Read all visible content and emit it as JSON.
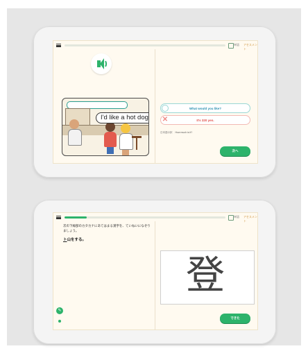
{
  "screen_1": {
    "progress_percent": 0,
    "hint_label": "単語",
    "hint_link": "アセスメント",
    "scene_text": "I'd like a hot dog.",
    "option_correct": "What would you like?",
    "option_wrong": "It's 320 yen.",
    "translation_label": "日本語の訳",
    "translation_text": "How much is it?",
    "next_button": "次へ"
  },
  "screen_2": {
    "progress_percent": 14,
    "hint_label": "単語",
    "hint_link": "アセスメント",
    "question": "次の下線部のカタカナにあてはまる漢字を、ていねいになぞりましょう。",
    "sentence_mark": "ト",
    "sentence_rest": "山をする。",
    "kanji": "登",
    "done_button": "できた"
  },
  "colors": {
    "accent": "#2db36b",
    "correct": "#2a8fb0",
    "wrong": "#e0504a",
    "screen_bg": "#fffaf0"
  },
  "icons": [
    "menu-icon",
    "speaker-icon",
    "hint-icon",
    "pencil-icon"
  ]
}
